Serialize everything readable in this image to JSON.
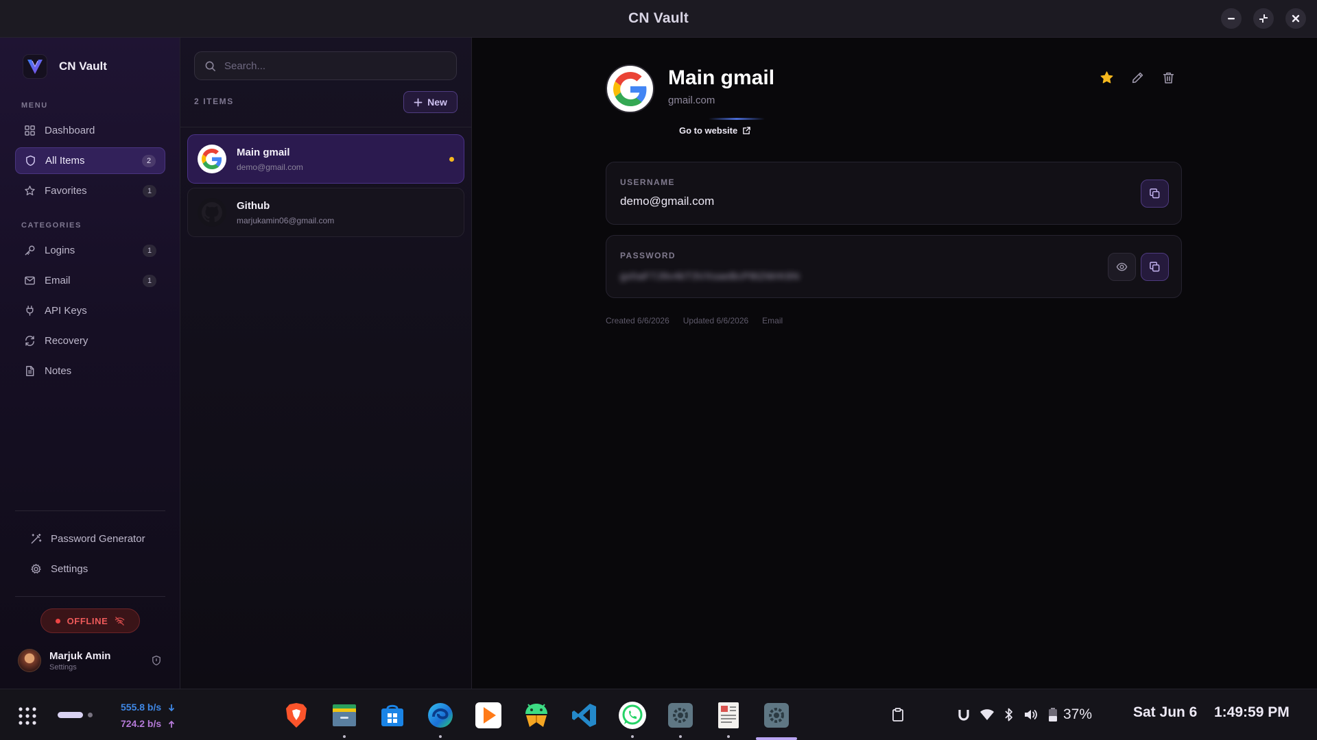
{
  "window": {
    "title": "CN Vault"
  },
  "sidebar": {
    "brand": "CN Vault",
    "menu_label": "MENU",
    "menu": [
      {
        "label": "Dashboard",
        "icon": "dashboard-icon",
        "count": null
      },
      {
        "label": "All Items",
        "icon": "shield-icon",
        "count": "2",
        "active": true
      },
      {
        "label": "Favorites",
        "icon": "star-icon",
        "count": "1"
      }
    ],
    "categories_label": "CATEGORIES",
    "categories": [
      {
        "label": "Logins",
        "icon": "key-icon",
        "count": "1"
      },
      {
        "label": "Email",
        "icon": "mail-icon",
        "count": "1"
      },
      {
        "label": "API Keys",
        "icon": "plug-icon",
        "count": null
      },
      {
        "label": "Recovery",
        "icon": "refresh-icon",
        "count": null
      },
      {
        "label": "Notes",
        "icon": "note-icon",
        "count": null
      }
    ],
    "tools": [
      {
        "label": "Password Generator",
        "icon": "wand-icon"
      },
      {
        "label": "Settings",
        "icon": "gear-icon"
      }
    ],
    "status": "OFFLINE",
    "user": {
      "name": "Marjuk Amin",
      "sub": "Settings"
    }
  },
  "list": {
    "search_placeholder": "Search...",
    "count_label": "2 ITEMS",
    "new_label": "New",
    "items": [
      {
        "title": "Main gmail",
        "subtitle": "demo@gmail.com",
        "icon": "google-icon",
        "favorite": true,
        "selected": true
      },
      {
        "title": "Github",
        "subtitle": "marjukamin06@gmail.com",
        "icon": "github-icon",
        "favorite": false,
        "selected": false
      }
    ]
  },
  "detail": {
    "title": "Main gmail",
    "domain": "gmail.com",
    "goto_label": "Go to website",
    "username_label": "USERNAME",
    "username_value": "demo@gmail.com",
    "password_label": "PASSWORD",
    "password_value": "gxhaF7J9v4kT3VXsaeBcP8t2WrK6N",
    "created": "Created 6/6/2026",
    "updated": "Updated 6/6/2026",
    "category": "Email",
    "colors": {
      "favorite": "#f5b81e",
      "accent": "#7c5cd6"
    }
  },
  "taskbar": {
    "net_down": "555.8  b/s",
    "net_up": "724.2  b/s",
    "apps": [
      "brave-icon",
      "files-icon",
      "store-icon",
      "edge-icon",
      "player-icon",
      "android-studio-icon",
      "vscode-icon",
      "whatsapp-icon",
      "settings-app-icon",
      "text-editor-icon",
      "cn-vault-icon"
    ],
    "battery": "37%",
    "date": "Sat Jun 6",
    "time": "1:49:59 PM"
  }
}
